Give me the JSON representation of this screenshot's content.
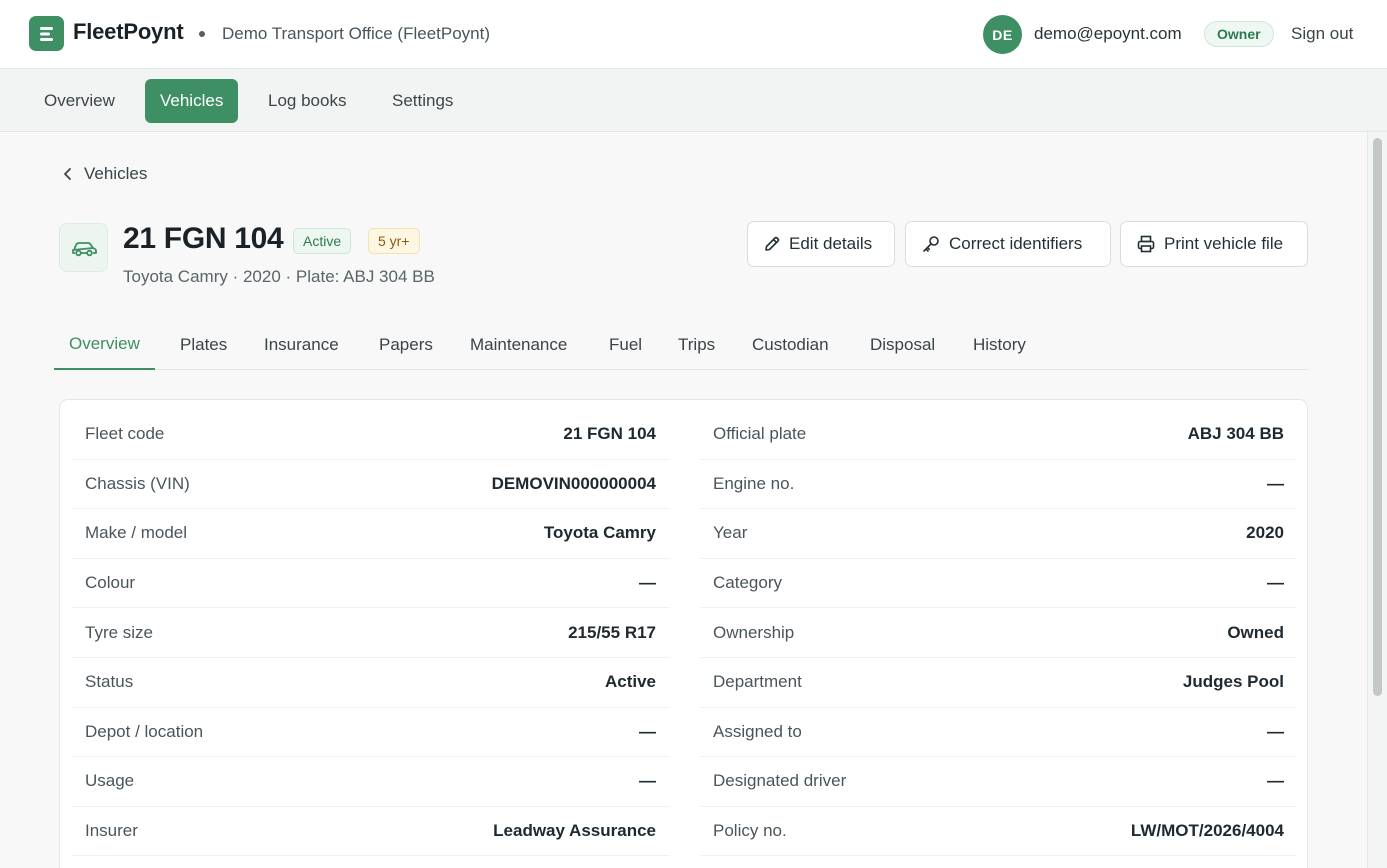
{
  "app": {
    "brand": "FleetPoynt",
    "org": "Demo Transport Office (FleetPoynt)",
    "accent": "#3e8f63"
  },
  "user": {
    "initials": "DE",
    "email": "demo@epoynt.com",
    "role": "Owner",
    "signout_label": "Sign out"
  },
  "nav": {
    "items": [
      {
        "label": "Overview"
      },
      {
        "label": "Vehicles",
        "active": true
      },
      {
        "label": "Log books"
      },
      {
        "label": "Settings"
      }
    ]
  },
  "back": {
    "label": "Vehicles"
  },
  "vehicle": {
    "title": "21 FGN 104",
    "status_badge": "Active",
    "age_badge": "5 yr+",
    "subtitle": "Toyota Camry · 2020 · Plate: ABJ 304 BB"
  },
  "actions": {
    "edit": "Edit details",
    "correct": "Correct identifiers",
    "print": "Print vehicle file"
  },
  "tabs": [
    {
      "label": "Overview",
      "active": true
    },
    {
      "label": "Plates"
    },
    {
      "label": "Insurance"
    },
    {
      "label": "Papers"
    },
    {
      "label": "Maintenance"
    },
    {
      "label": "Fuel"
    },
    {
      "label": "Trips"
    },
    {
      "label": "Custodian"
    },
    {
      "label": "Disposal"
    },
    {
      "label": "History"
    }
  ],
  "details": {
    "left": [
      {
        "label": "Fleet code",
        "value": "21 FGN 104"
      },
      {
        "label": "Chassis (VIN)",
        "value": "DEMOVIN000000004"
      },
      {
        "label": "Make / model",
        "value": "Toyota Camry"
      },
      {
        "label": "Colour",
        "value": "—"
      },
      {
        "label": "Tyre size",
        "value": "215/55 R17"
      },
      {
        "label": "Status",
        "value": "Active"
      },
      {
        "label": "Depot / location",
        "value": "—"
      },
      {
        "label": "Usage",
        "value": "—"
      },
      {
        "label": "Insurer",
        "value": "Leadway Assurance"
      }
    ],
    "right": [
      {
        "label": "Official plate",
        "value": "ABJ 304 BB"
      },
      {
        "label": "Engine no.",
        "value": "—"
      },
      {
        "label": "Year",
        "value": "2020"
      },
      {
        "label": "Category",
        "value": "—"
      },
      {
        "label": "Ownership",
        "value": "Owned"
      },
      {
        "label": "Department",
        "value": "Judges Pool"
      },
      {
        "label": "Assigned to",
        "value": "—"
      },
      {
        "label": "Designated driver",
        "value": "—"
      },
      {
        "label": "Policy no.",
        "value": "LW/MOT/2026/4004"
      }
    ]
  }
}
